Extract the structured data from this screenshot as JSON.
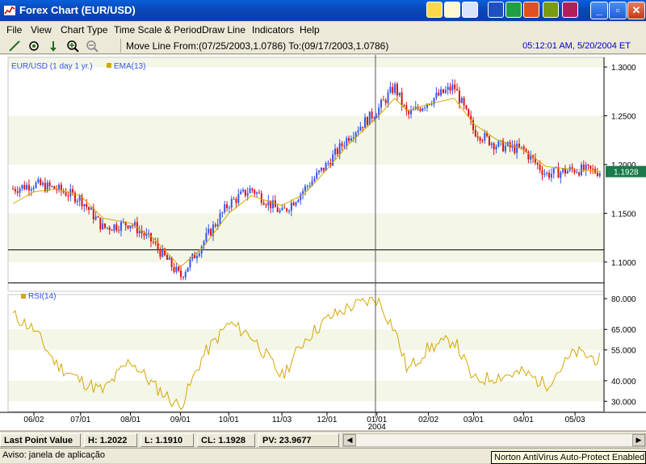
{
  "window": {
    "title": "Forex Chart (EUR/USD)"
  },
  "menu": [
    "File",
    "View",
    "Chart Type",
    "Time Scale & Period",
    "Draw Line",
    "Indicators",
    "Help"
  ],
  "toolbar": {
    "tools": [
      "draw-line-icon",
      "crosshair-icon",
      "arrow-down-icon",
      "zoom-in-icon",
      "zoom-out-icon"
    ],
    "status_text": "Move Line From:(07/25/2003,1.0786) To:(09/17/2003,1.0786)",
    "clock": "05:12:01 AM, 5/20/2004 ET"
  },
  "price_panel": {
    "legend_symbol": "EUR/USD (1 day  1 yr.)",
    "legend_ema": "EMA(13)",
    "y_ticks": [
      "1.3000",
      "1.2500",
      "1.2000",
      "1.1500",
      "1.1000"
    ],
    "last_price": "1.1928",
    "last_price_color": "#1a7a4a"
  },
  "rsi_panel": {
    "legend": "RSI(14)",
    "y_ticks": [
      "80.000",
      "65.000",
      "55.000",
      "40.000",
      "30.000"
    ]
  },
  "x_axis": {
    "labels": [
      "06/02",
      "07/01",
      "08/01",
      "09/01",
      "10/01",
      "11/03",
      "12/01",
      "01/01",
      "02/02",
      "03/01",
      "04/01",
      "05/03"
    ],
    "year_label": "2004"
  },
  "infobar": {
    "last_point_label": "Last Point Value",
    "high": "H: 1.2022",
    "low": "L: 1.1910",
    "close": "CL: 1.1928",
    "pv": "PV: 23.9677"
  },
  "statusbar": {
    "aviso": "Aviso: janela de aplicação",
    "norton": "Norton AntiVirus Auto-Protect Enabled"
  },
  "colors": {
    "up_candle": "#3355ee",
    "down_candle": "#dd1111",
    "ema": "#d4a800",
    "rsi": "#d4a800",
    "band": "#f4f6e8"
  },
  "chart_data": [
    {
      "type": "candlestick",
      "title": "EUR/USD (1 day  1 yr.)",
      "ylim": [
        1.07,
        1.31
      ],
      "x_labels": [
        "06/02",
        "07/01",
        "08/01",
        "09/01",
        "10/01",
        "11/03",
        "12/01",
        "01/01",
        "02/02",
        "03/01",
        "04/01",
        "05/03"
      ],
      "series": [
        {
          "name": "EUR/USD",
          "x": [
            "2003-05-20",
            "2003-06-02",
            "2003-06-16",
            "2003-07-01",
            "2003-07-15",
            "2003-08-01",
            "2003-08-15",
            "2003-09-01",
            "2003-09-15",
            "2003-10-01",
            "2003-10-15",
            "2003-11-03",
            "2003-11-17",
            "2003-12-01",
            "2003-12-15",
            "2004-01-01",
            "2004-01-12",
            "2004-01-20",
            "2004-02-02",
            "2004-02-18",
            "2004-03-01",
            "2004-03-15",
            "2004-04-01",
            "2004-04-15",
            "2004-05-03",
            "2004-05-19"
          ],
          "close": [
            1.175,
            1.18,
            1.175,
            1.165,
            1.135,
            1.14,
            1.12,
            1.085,
            1.12,
            1.16,
            1.175,
            1.15,
            1.175,
            1.2,
            1.23,
            1.255,
            1.28,
            1.25,
            1.265,
            1.28,
            1.235,
            1.22,
            1.215,
            1.19,
            1.195,
            1.1928
          ]
        },
        {
          "name": "EMA(13)",
          "x": [
            "2003-05-20",
            "2003-06-02",
            "2003-06-16",
            "2003-07-01",
            "2003-07-15",
            "2003-08-01",
            "2003-08-15",
            "2003-09-01",
            "2003-09-15",
            "2003-10-01",
            "2003-10-15",
            "2003-11-03",
            "2003-11-17",
            "2003-12-01",
            "2003-12-15",
            "2004-01-01",
            "2004-01-12",
            "2004-01-20",
            "2004-02-02",
            "2004-02-18",
            "2004-03-01",
            "2004-03-15",
            "2004-04-01",
            "2004-04-15",
            "2004-05-03",
            "2004-05-19"
          ],
          "values": [
            1.16,
            1.172,
            1.175,
            1.168,
            1.145,
            1.14,
            1.125,
            1.095,
            1.115,
            1.15,
            1.168,
            1.158,
            1.17,
            1.195,
            1.222,
            1.248,
            1.268,
            1.255,
            1.262,
            1.268,
            1.242,
            1.226,
            1.215,
            1.198,
            1.195,
            1.193
          ]
        }
      ],
      "horizontal_lines": [
        1.1125,
        1.0786
      ]
    },
    {
      "type": "line",
      "title": "RSI(14)",
      "ylim": [
        25,
        82
      ],
      "series": [
        {
          "name": "RSI(14)",
          "x": [
            "2003-05-20",
            "2003-06-02",
            "2003-06-16",
            "2003-07-01",
            "2003-07-15",
            "2003-08-01",
            "2003-08-15",
            "2003-09-01",
            "2003-09-15",
            "2003-10-01",
            "2003-10-15",
            "2003-11-03",
            "2003-11-17",
            "2003-12-01",
            "2003-12-15",
            "2004-01-01",
            "2004-01-12",
            "2004-01-20",
            "2004-02-02",
            "2004-02-18",
            "2004-03-01",
            "2004-03-15",
            "2004-04-01",
            "2004-04-15",
            "2004-05-03",
            "2004-05-19"
          ],
          "values": [
            72,
            65,
            48,
            40,
            35,
            50,
            38,
            27,
            52,
            68,
            62,
            42,
            60,
            70,
            76,
            80,
            65,
            45,
            56,
            60,
            40,
            42,
            44,
            38,
            54,
            50
          ]
        }
      ]
    }
  ]
}
